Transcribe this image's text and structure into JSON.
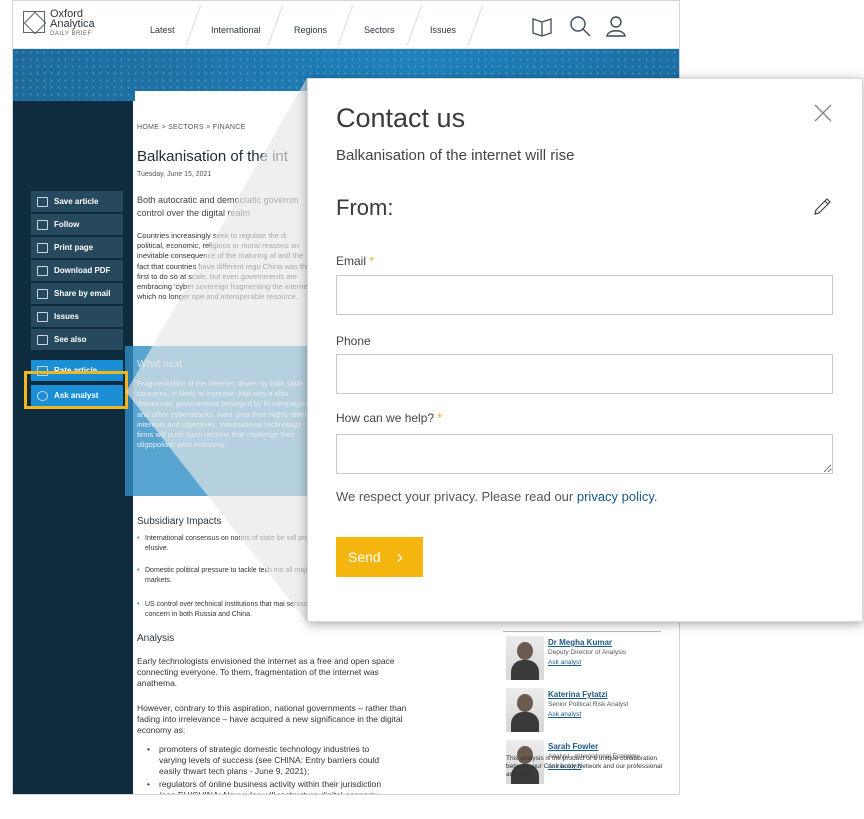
{
  "nav": {
    "logo": [
      "Oxford",
      "Analytica",
      "DAILY BRIEF"
    ],
    "items": [
      "Latest",
      "International",
      "Regions",
      "Sectors",
      "Issues"
    ],
    "icons": [
      "book-icon",
      "search-icon",
      "user-icon"
    ]
  },
  "sidebar": {
    "tools": [
      "Save article",
      "Follow",
      "Print page",
      "Download PDF",
      "Share by email",
      "Issues",
      "See also"
    ],
    "rate": "Rate article",
    "ask": "Ask analyst"
  },
  "article": {
    "breadcrumb": "HOME > SECTORS > FINANCE",
    "title": "Balkanisation of the int",
    "date": "Tuesday, June 15, 2021",
    "summary": "Both autocratic and democratic governm control over the digital realm",
    "body": "Countries increasingly seek to regulate the di political, economic, religious or moral reasons an inevitable consequence of the maturing of and the fact that countries have different regu China was the first to do so at scale, but even governments are embracing 'cyber sovereign fragmenting the internet, which no longer ope and interoperable resource.",
    "what_next_title": "What next",
    "what_next_body": "Fragmentation of the internet, driven by both state concerns, is likely to increase. Not only a also democratic governments besieged by fo campaigns and other cyberattacks, want grea their highly differing interests and objectives. transnational technology firms will push back reforms that challenge their oligopolistic posi economy.",
    "subsidiary_title": "Subsidiary Impacts",
    "impacts": [
      "International consensus on norms of state be will prove elusive.",
      "Domestic political pressure to tackle tech mo all major markets.",
      "US control over technical institutions that mai serious concern in both Russia and China."
    ],
    "analysis_title": "Analysis",
    "para1": "Early technologists envisioned the internet as a free and open space connecting everyone. To them, fragmentation of the internet was anathema.",
    "para2": "However, contrary to this aspiration, national governments – rather than fading into irrelevance – have acquired a new significance in the digital economy as:",
    "bullets": [
      "promoters of strategic domestic technology industries to varying levels of success (see CHINA: Entry barriers could easily thwart tech plans - June 9, 2021);",
      "regulators of online business activity within their jurisdiction (see EU/CHINA: New rules will restructure digital economy - February 17, 2021); and/or"
    ]
  },
  "experts": {
    "people": [
      {
        "name": "Dr Megha Kumar",
        "role": "Deputy Director of Analysis",
        "ask": "Ask analyst"
      },
      {
        "name": "Katerina Fytatzi",
        "role": "Senior Political Risk Analyst",
        "ask": "Ask analyst"
      },
      {
        "name": "Sarah Fowler",
        "role": "Analyst - International Economy",
        "ask": "Ask analyst"
      }
    ],
    "note": "This analysis is the product of a unique collaboration between our Contributor Network and our professional analysts."
  },
  "modal": {
    "title": "Contact us",
    "subtitle": "Balkanisation of the internet will rise",
    "from": "From:",
    "email_label": "Email",
    "phone_label": "Phone",
    "help_label": "How can we help?",
    "required_mark": "*",
    "privacy_text": "We respect your privacy. Please read our",
    "privacy_link": "privacy policy.",
    "send": "Send",
    "send_chevron": "›"
  },
  "colors": {
    "accent_yellow": "#f5b50f",
    "brand_blue": "#1b8fd6",
    "sidebar_dark": "#0f2c3e"
  }
}
